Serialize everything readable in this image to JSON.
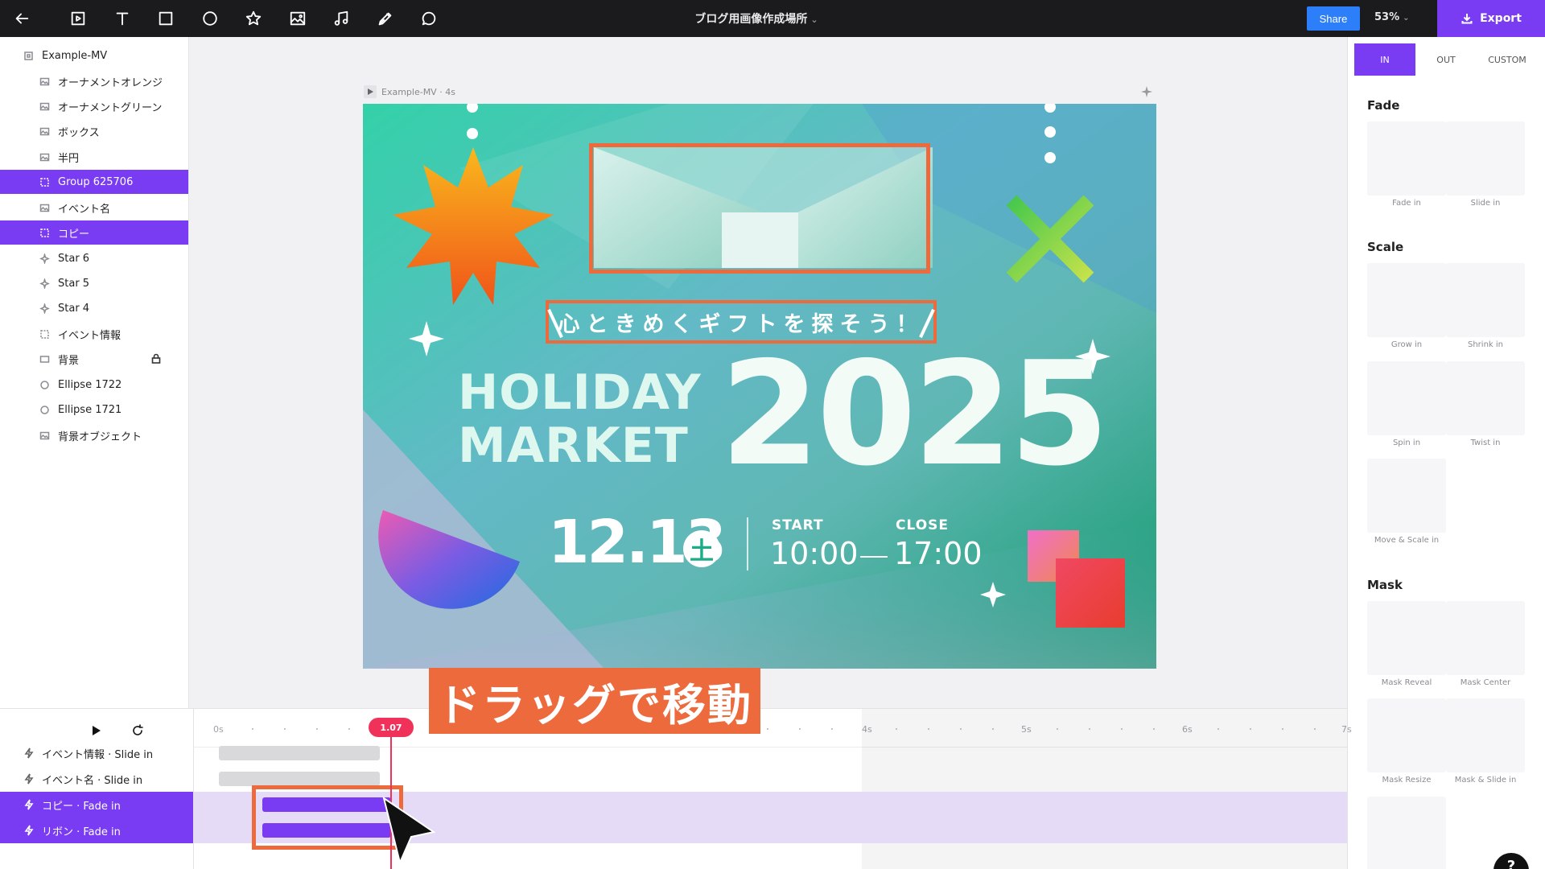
{
  "topbar": {
    "document_title": "ブログ用画像作成場所",
    "share_label": "Share",
    "zoom": "53%",
    "export_label": "Export"
  },
  "layers": [
    {
      "label": "Example-MV",
      "icon": "artboard-icon",
      "selected": false
    },
    {
      "label": "オーナメントオレンジ",
      "icon": "image-icon",
      "selected": false
    },
    {
      "label": "オーナメントグリーン",
      "icon": "image-icon",
      "selected": false
    },
    {
      "label": "ボックス",
      "icon": "image-icon",
      "selected": false
    },
    {
      "label": "半円",
      "icon": "image-icon",
      "selected": false
    },
    {
      "label": "Group 625706",
      "icon": "group-icon",
      "selected": true
    },
    {
      "label": "イベント名",
      "icon": "image-icon",
      "selected": false
    },
    {
      "label": "コピー",
      "icon": "group-icon",
      "selected": true
    },
    {
      "label": "Star 6",
      "icon": "star-icon",
      "selected": false
    },
    {
      "label": "Star 5",
      "icon": "star-icon",
      "selected": false
    },
    {
      "label": "Star 4",
      "icon": "star-icon",
      "selected": false
    },
    {
      "label": "イベント情報",
      "icon": "group-icon",
      "selected": false
    },
    {
      "label": "背景",
      "icon": "rectangle-icon",
      "selected": false,
      "locked": true
    },
    {
      "label": "Ellipse 1722",
      "icon": "ellipse-icon",
      "selected": false
    },
    {
      "label": "Ellipse 1721",
      "icon": "ellipse-icon",
      "selected": false
    },
    {
      "label": "背景オブジェクト",
      "icon": "image-icon",
      "selected": false
    }
  ],
  "canvas": {
    "artboard_label": "Example-MV · 4s",
    "artwork": {
      "copy": "心ときめくギフトを探そう！",
      "holiday_line1": "HOLIDAY",
      "holiday_line2": "MARKET",
      "year": "2025",
      "date": "12.13",
      "weekday": "土",
      "start_label": "START",
      "start_time": "10:00",
      "close_label": "CLOSE",
      "close_time": "17:00"
    }
  },
  "callout": "ドラッグで移動",
  "right_panel": {
    "tabs": [
      "IN",
      "OUT",
      "CUSTOM"
    ],
    "active_tab": "IN",
    "sections": [
      {
        "title": "Fade",
        "items": [
          "Fade in",
          "Slide in"
        ]
      },
      {
        "title": "Scale",
        "items": [
          "Grow in",
          "Shrink in",
          "Spin in",
          "Twist in",
          "Move & Scale in"
        ]
      },
      {
        "title": "Mask",
        "items": [
          "Mask Reveal",
          "Mask Center",
          "Mask Resize",
          "Mask & Slide in"
        ]
      }
    ],
    "help_label": "?"
  },
  "timeline": {
    "playhead": "1.07",
    "ticks": [
      "0s",
      "4s",
      "5s",
      "6s",
      "7s"
    ],
    "tracks": [
      {
        "label": "イベント情報 · Slide in",
        "selected": false
      },
      {
        "label": "イベント名 · Slide in",
        "selected": false
      },
      {
        "label": "コピー · Fade in",
        "selected": true
      },
      {
        "label": "リボン · Fade in",
        "selected": true
      }
    ]
  },
  "colors": {
    "accent": "#7a3cf2",
    "share": "#2d7ff9",
    "highlight": "#ec6a3c",
    "playhead": "#f0325a"
  }
}
